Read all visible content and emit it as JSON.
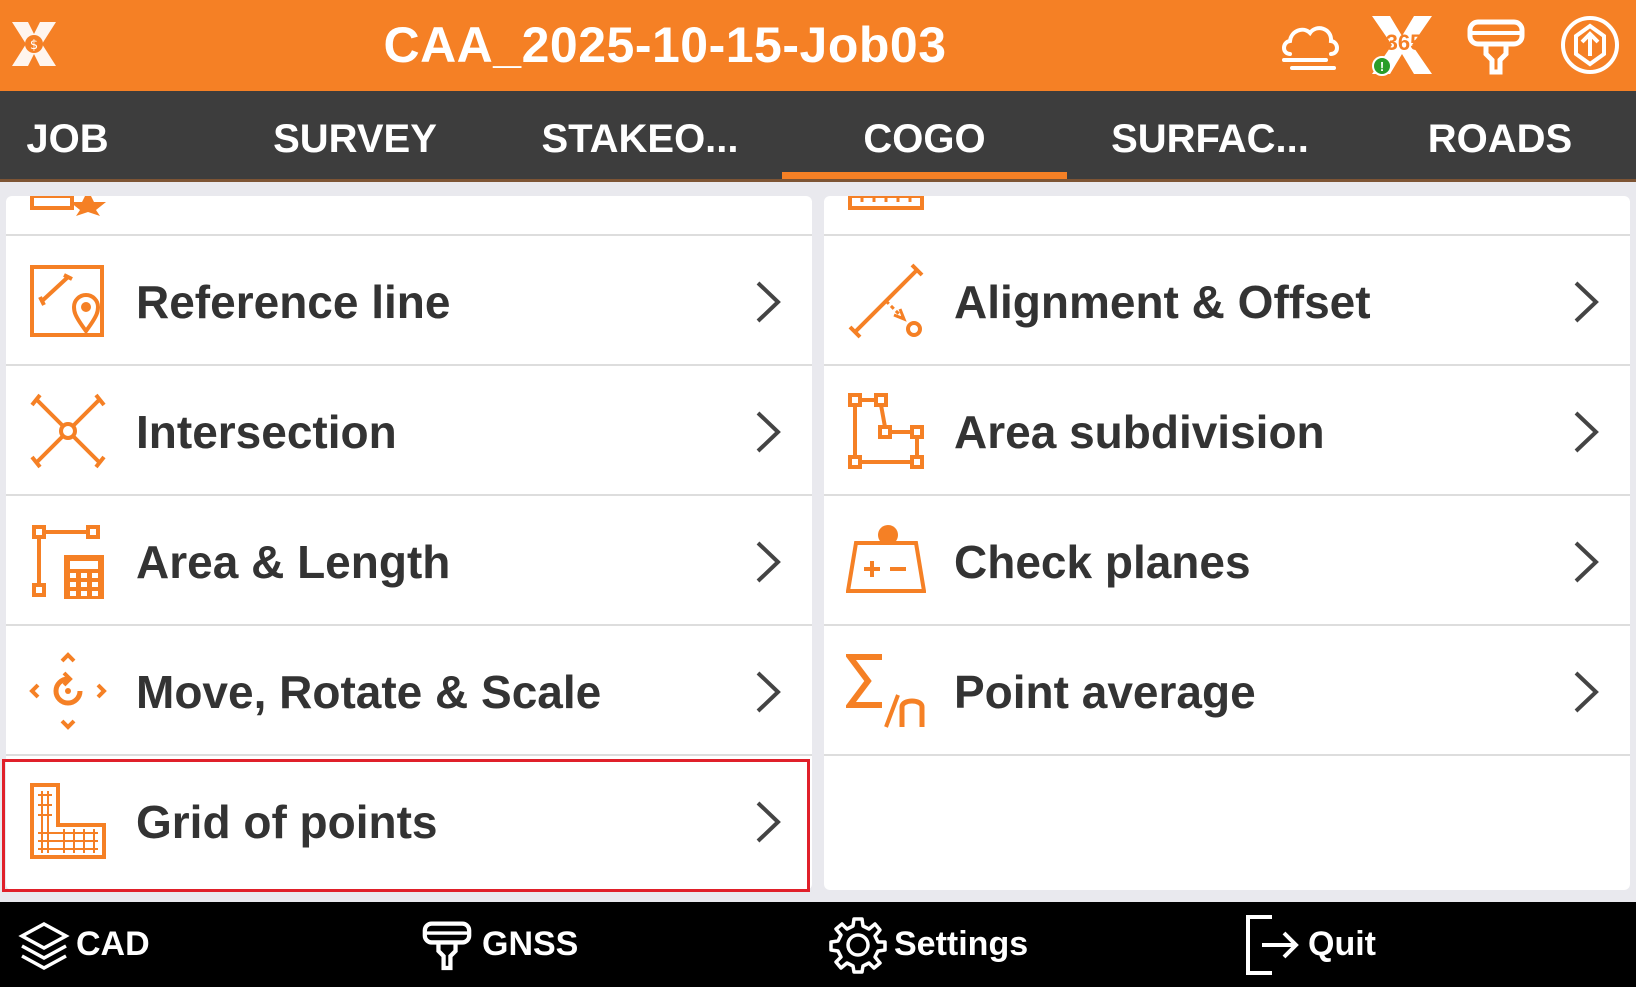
{
  "app": {
    "title": "CAA_2025-10-15-Job03",
    "status_badge": "365"
  },
  "tabs": [
    {
      "label": "JOB"
    },
    {
      "label": "SURVEY"
    },
    {
      "label": "STAKEO..."
    },
    {
      "label": "COGO",
      "active": true
    },
    {
      "label": "SURFAC..."
    },
    {
      "label": "ROADS"
    }
  ],
  "left_items": [
    {
      "label": "Reference line",
      "icon": "reference-line-icon"
    },
    {
      "label": "Intersection",
      "icon": "intersection-icon"
    },
    {
      "label": "Area & Length",
      "icon": "area-length-icon"
    },
    {
      "label": "Move, Rotate & Scale",
      "icon": "move-rotate-scale-icon"
    },
    {
      "label": "Grid of points",
      "icon": "grid-of-points-icon",
      "highlighted": true
    }
  ],
  "right_items": [
    {
      "label": "Alignment & Offset",
      "icon": "alignment-offset-icon"
    },
    {
      "label": "Area subdivision",
      "icon": "area-subdivision-icon"
    },
    {
      "label": "Check planes",
      "icon": "check-planes-icon"
    },
    {
      "label": "Point average",
      "icon": "point-average-icon"
    }
  ],
  "bottom": {
    "cad": "CAD",
    "gnss": "GNSS",
    "settings": "Settings",
    "quit": "Quit"
  },
  "colors": {
    "accent": "#f58025",
    "tabbar": "#3d3d3d",
    "bottombar": "#000000",
    "highlight": "#e0202a"
  }
}
